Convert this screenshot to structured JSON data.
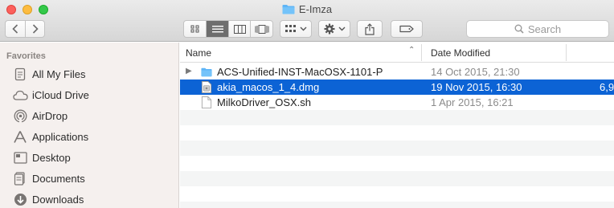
{
  "window": {
    "title": "E-Imza"
  },
  "toolbar": {
    "back_icon": "chevron-left-icon",
    "forward_icon": "chevron-right-icon",
    "search_placeholder": "Search",
    "views": [
      "icon-view",
      "list-view",
      "column-view",
      "cover-flow-view"
    ],
    "active_view": "list-view"
  },
  "sidebar": {
    "heading": "Favorites",
    "items": [
      {
        "label": "All My Files",
        "icon": "all-files-icon"
      },
      {
        "label": "iCloud Drive",
        "icon": "cloud-icon"
      },
      {
        "label": "AirDrop",
        "icon": "airdrop-icon"
      },
      {
        "label": "Applications",
        "icon": "applications-icon"
      },
      {
        "label": "Desktop",
        "icon": "desktop-icon"
      },
      {
        "label": "Documents",
        "icon": "documents-icon"
      },
      {
        "label": "Downloads",
        "icon": "downloads-icon"
      }
    ]
  },
  "columns": {
    "name": "Name",
    "date": "Date Modified"
  },
  "files": [
    {
      "name": "ACS-Unified-INST-MacOSX-1101-P",
      "date": "14 Oct 2015, 21:30",
      "kind": "folder",
      "size": ""
    },
    {
      "name": "akia_macos_1_4.dmg",
      "date": "19 Nov 2015, 16:30",
      "kind": "dmg",
      "size": "6,9",
      "selected": true
    },
    {
      "name": "MilkoDriver_OSX.sh",
      "date": "1 Apr 2015, 16:21",
      "kind": "script",
      "size": ""
    }
  ],
  "colors": {
    "selection": "#0c63d5",
    "folder": "#5eb5f7"
  }
}
